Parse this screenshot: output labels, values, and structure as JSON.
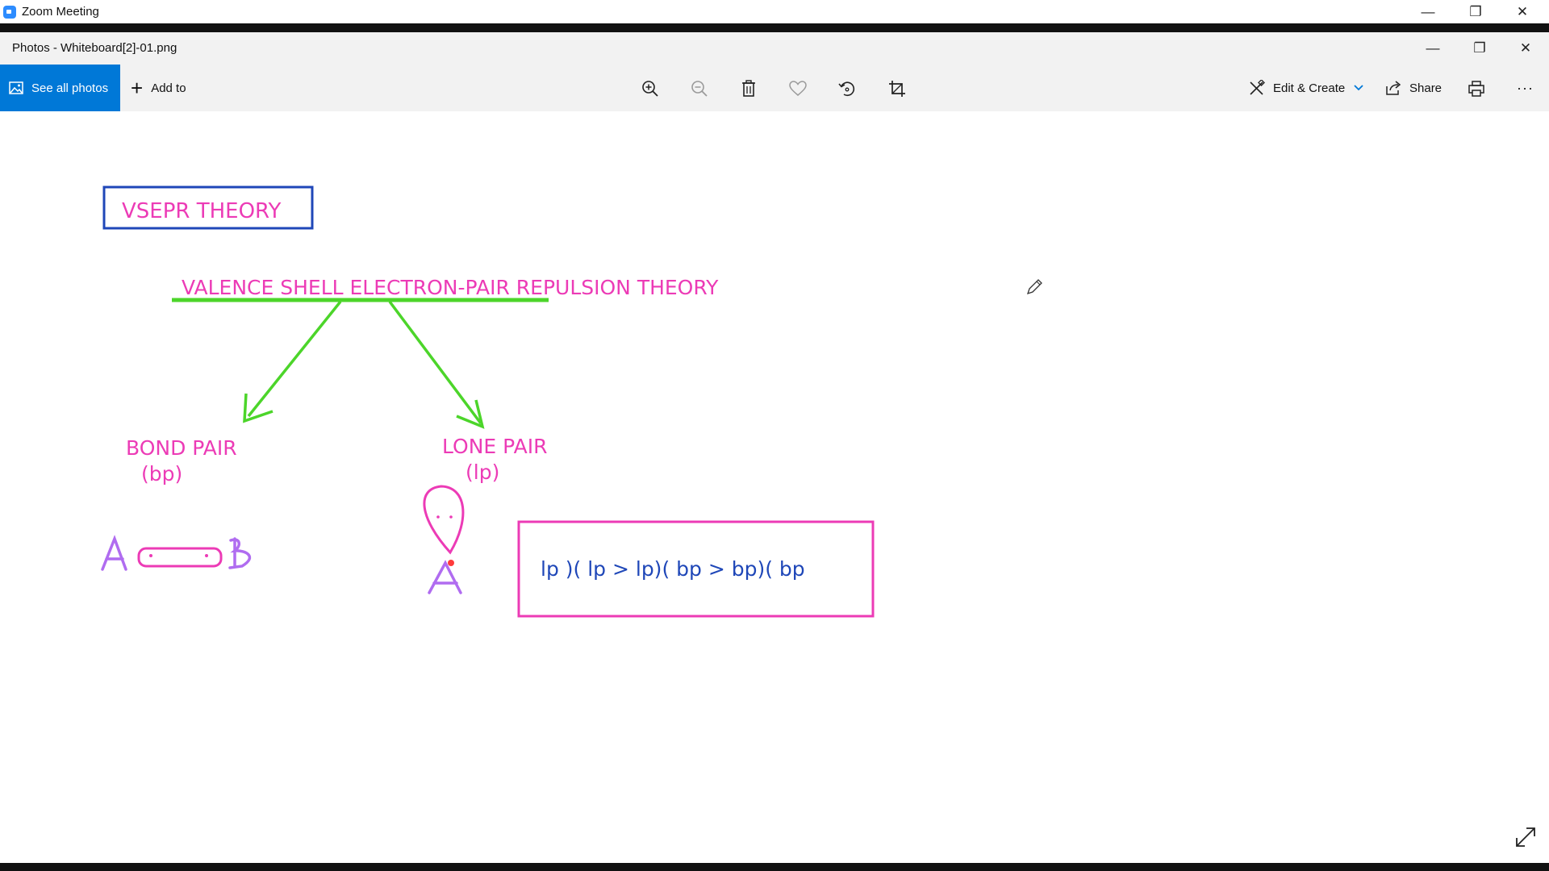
{
  "zoom": {
    "title": "Zoom Meeting",
    "controls": {
      "minimize": "—",
      "restore": "❐",
      "close": "✕"
    }
  },
  "photos": {
    "title": "Photos - Whiteboard[2]-01.png",
    "controls": {
      "minimize": "—",
      "restore": "❐",
      "close": "✕"
    }
  },
  "toolbar": {
    "see_all": "See all photos",
    "add_to": "Add to",
    "add_plus": "+",
    "edit_create": "Edit & Create",
    "share": "Share",
    "more": "···",
    "accent": "#0078d7"
  },
  "whiteboard": {
    "title_box": "VSEPR THEORY",
    "subtitle": "VALENCE SHELL ELECTRON-PAIR REPULSION THEORY",
    "bond_pair": "BOND PAIR",
    "bond_pair_abbr": "(bp)",
    "lone_pair": "LONE PAIR",
    "lone_pair_abbr": "(lp)",
    "repulsion_order": "lp )( lp > lp)( bp > bp)( bp",
    "colors": {
      "pink": "#ec3bb6",
      "blue": "#1f47b8",
      "green": "#4cd52a",
      "purple": "#b06cf0"
    }
  }
}
